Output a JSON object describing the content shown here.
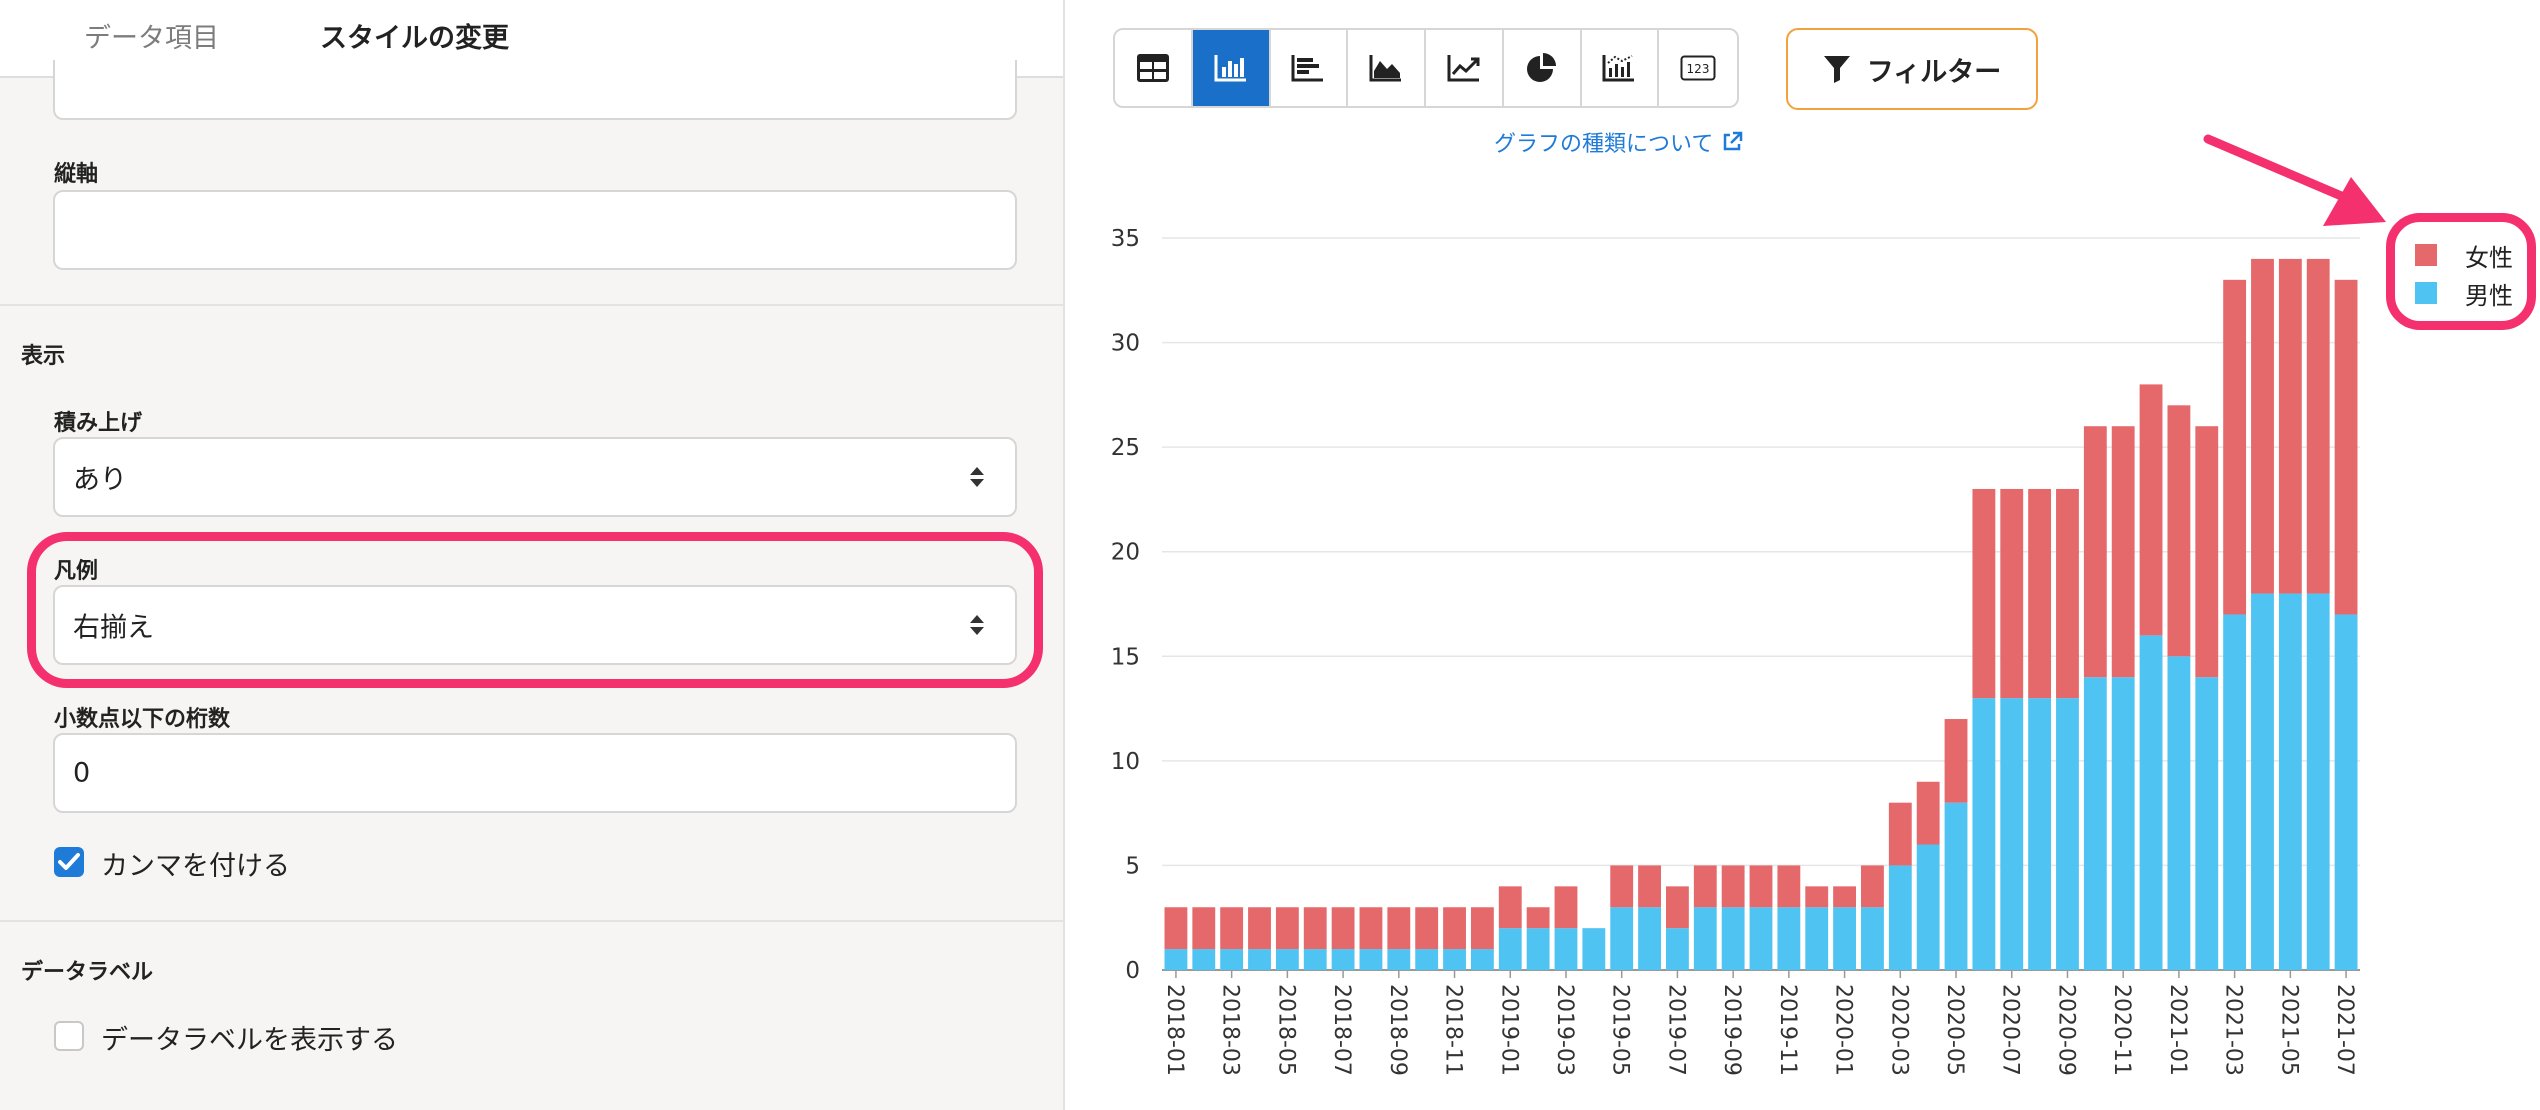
{
  "tabs": {
    "data_items": "データ項目",
    "style_change": "スタイルの変更"
  },
  "panel": {
    "vertical_axis_label": "縦軸",
    "vertical_axis_value": "",
    "display_section": "表示",
    "stacking_label": "積み上げ",
    "stacking_value": "あり",
    "legend_label": "凡例",
    "legend_value": "右揃え",
    "decimals_label": "小数点以下の桁数",
    "decimals_value": "0",
    "comma_label": "カンマを付ける",
    "comma_checked": true,
    "data_label_section": "データラベル",
    "show_data_label": "データラベルを表示する",
    "show_data_label_checked": false
  },
  "toolbar": {
    "icons": [
      "table-icon",
      "bar-chart-icon",
      "horizontal-bar-icon",
      "area-chart-icon",
      "line-chart-icon",
      "pie-chart-icon",
      "combo-chart-icon",
      "number-icon"
    ],
    "active_index": 1,
    "filter_label": "フィルター",
    "chart_type_link": "グラフの種類について"
  },
  "colors": {
    "female": "#e5686a",
    "male": "#4fc3f2",
    "accent": "#1f7bd8",
    "highlight": "#f4306f"
  },
  "chart_data": {
    "type": "bar",
    "stacked": true,
    "x": [
      "2018-01",
      "2018-02",
      "2018-03",
      "2018-04",
      "2018-05",
      "2018-06",
      "2018-07",
      "2018-08",
      "2018-09",
      "2018-10",
      "2018-11",
      "2018-12",
      "2019-01",
      "2019-02",
      "2019-03",
      "2019-04",
      "2019-05",
      "2019-06",
      "2019-07",
      "2019-08",
      "2019-09",
      "2019-10",
      "2019-11",
      "2019-12",
      "2020-01",
      "2020-02",
      "2020-03",
      "2020-04",
      "2020-05",
      "2020-06",
      "2020-07",
      "2020-08",
      "2020-09",
      "2020-10",
      "2020-11",
      "2020-12",
      "2021-01",
      "2021-02",
      "2021-03",
      "2021-04",
      "2021-05",
      "2021-06",
      "2021-07"
    ],
    "tick_labels": [
      "2018-01",
      "2018-03",
      "2018-05",
      "2018-07",
      "2018-09",
      "2018-11",
      "2019-01",
      "2019-03",
      "2019-05",
      "2019-07",
      "2019-09",
      "2019-11",
      "2020-01",
      "2020-03",
      "2020-05",
      "2020-07",
      "2020-09",
      "2020-11",
      "2021-01",
      "2021-03",
      "2021-05",
      "2021-07"
    ],
    "series": [
      {
        "name": "男性",
        "values": [
          1,
          1,
          1,
          1,
          1,
          1,
          1,
          1,
          1,
          1,
          1,
          1,
          2,
          2,
          2,
          2,
          3,
          3,
          2,
          3,
          3,
          3,
          3,
          3,
          3,
          3,
          5,
          6,
          8,
          13,
          13,
          13,
          13,
          14,
          14,
          16,
          15,
          14,
          17,
          18,
          18,
          18,
          17
        ]
      },
      {
        "name": "女性",
        "values": [
          2,
          2,
          2,
          2,
          2,
          2,
          2,
          2,
          2,
          2,
          2,
          2,
          2,
          1,
          2,
          0,
          2,
          2,
          2,
          2,
          2,
          2,
          2,
          1,
          1,
          2,
          3,
          3,
          4,
          10,
          10,
          10,
          10,
          12,
          12,
          12,
          12,
          12,
          16,
          16,
          16,
          16,
          16
        ]
      }
    ],
    "legend_order": [
      "女性",
      "男性"
    ],
    "y_ticks": [
      0,
      5,
      10,
      15,
      20,
      25,
      30,
      35
    ],
    "ylim": [
      0,
      35
    ],
    "grid": true,
    "legend_position": "top-right"
  }
}
